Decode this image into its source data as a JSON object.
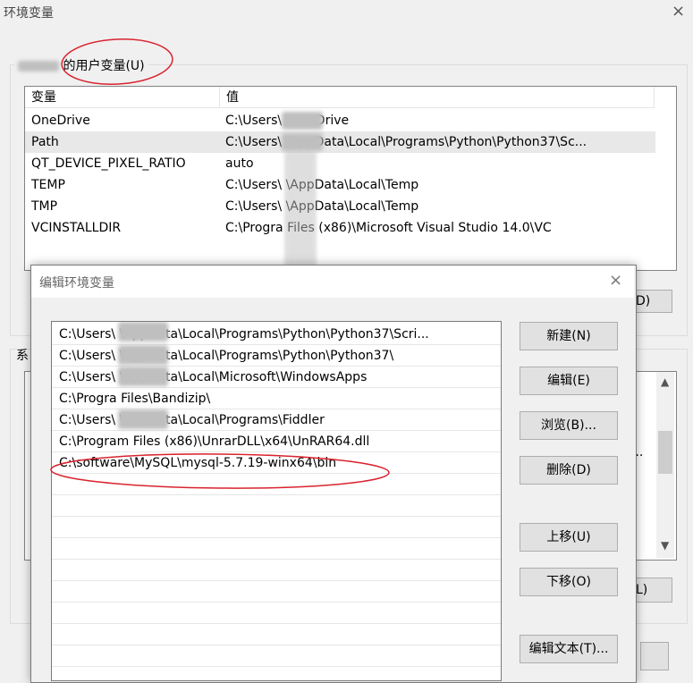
{
  "outer_dialog": {
    "title": "环境变量",
    "close_glyph": "×",
    "user_vars_label": "的用户变量(U)",
    "user_list": {
      "columns": [
        "变量",
        "值"
      ],
      "rows": [
        {
          "name": "OneDrive",
          "value": "C:\\Users\\   \\OneDrive"
        },
        {
          "name": "Path",
          "value": "C:\\Users\\   \\AppData\\Local\\Programs\\Python\\Python37\\Sc..."
        },
        {
          "name": "QT_DEVICE_PIXEL_RATIO",
          "value": "auto"
        },
        {
          "name": "TEMP",
          "value": "C:\\Users\\   \\AppData\\Local\\Temp"
        },
        {
          "name": "TMP",
          "value": "C:\\Users\\   \\AppData\\Local\\Temp"
        },
        {
          "name": "VCINSTALLDIR",
          "value": "C:\\Progra   Files (x86)\\Microsoft Visual Studio 14.0\\VC"
        }
      ]
    },
    "user_button_fragment": "D)",
    "sys_vars_label": "系",
    "sys_row_fragment": "...",
    "sys_button_fragment": "L)"
  },
  "inner_dialog": {
    "title": "编辑环境变量",
    "close_glyph": "×",
    "paths": [
      "C:\\Users\\   \\AppData\\Local\\Programs\\Python\\Python37\\Scri...",
      "C:\\Users\\   \\AppData\\Local\\Programs\\Python\\Python37\\",
      "C:\\Users\\   \\AppData\\Local\\Microsoft\\WindowsApps",
      "C:\\Progra   Files\\Bandizip\\",
      "C:\\Users\\   \\AppData\\Local\\Programs\\Fiddler",
      "C:\\Program Files (x86)\\UnrarDLL\\x64\\UnRAR64.dll",
      "C:\\software\\MySQL\\mysql-5.7.19-winx64\\bin"
    ],
    "buttons": {
      "new": "新建(N)",
      "edit": "编辑(E)",
      "browse": "浏览(B)...",
      "delete": "删除(D)",
      "move_up": "上移(U)",
      "move_down": "下移(O)",
      "edit_text": "编辑文本(T)..."
    }
  },
  "colors": {
    "annotation": "#d9232e",
    "dialog_bg": "#f0f0f0",
    "selected_row": "#e8e8e8"
  }
}
